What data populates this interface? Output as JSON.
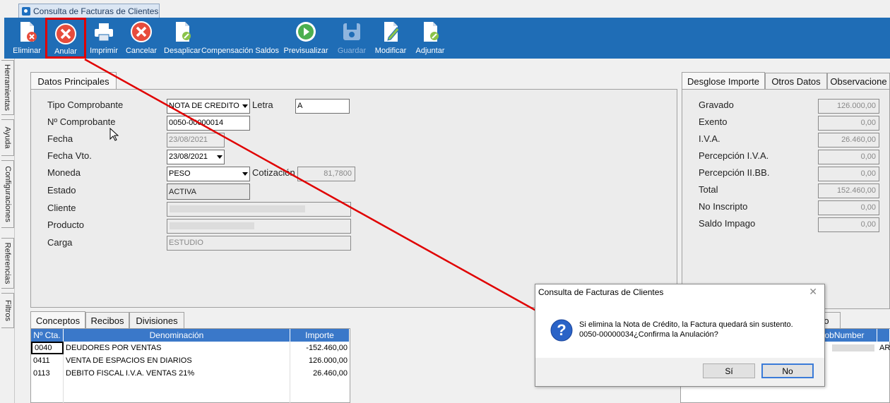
{
  "window": {
    "tab_title": "Consulta de Facturas de Clientes"
  },
  "toolbar": {
    "buttons": [
      {
        "label": "Eliminar",
        "icon": "delete-document-icon",
        "enabled": true
      },
      {
        "label": "Anular",
        "icon": "cancel-x-icon",
        "enabled": true,
        "highlighted": true
      },
      {
        "label": "Imprimir",
        "icon": "printer-icon",
        "enabled": true
      },
      {
        "label": "Cancelar",
        "icon": "cancel-x-icon",
        "enabled": true
      },
      {
        "label": "Desaplicar",
        "icon": "document-edit-icon",
        "enabled": true
      },
      {
        "label": "Compensación Saldos",
        "icon": "document-edit-icon",
        "enabled": true
      },
      {
        "label": "Previsualizar",
        "icon": "play-icon",
        "enabled": true
      },
      {
        "label": "Guardar",
        "icon": "save-icon",
        "enabled": false
      },
      {
        "label": "Modificar",
        "icon": "document-pencil-icon",
        "enabled": true
      },
      {
        "label": "Adjuntar",
        "icon": "document-edit-icon",
        "enabled": true
      }
    ]
  },
  "side_tabs": [
    "Herramientas",
    "Ayuda",
    "Configuraciones",
    "Referencias",
    "Filtros"
  ],
  "main_tab": "Datos Principales",
  "form": {
    "tipo_comprobante_label": "Tipo Comprobante",
    "tipo_comprobante": "NOTA DE CREDITO",
    "letra_label": "Letra",
    "letra": "A",
    "numero_label": "Nº Comprobante",
    "numero": "0050-00000014",
    "fecha_label": "Fecha",
    "fecha": "23/08/2021",
    "fecha_vto_label": "Fecha Vto.",
    "fecha_vto": "23/08/2021",
    "moneda_label": "Moneda",
    "moneda": "PESO",
    "cotizacion_label": "Cotización",
    "cotizacion": "81,7800",
    "estado_label": "Estado",
    "estado": "ACTIVA",
    "cliente_label": "Cliente",
    "producto_label": "Producto",
    "carga_label": "Carga",
    "carga": "ESTUDIO"
  },
  "right_tabs": [
    "Desglose Importe",
    "Otros Datos",
    "Observacione"
  ],
  "desglose": [
    {
      "label": "Gravado",
      "value": "126.000,00"
    },
    {
      "label": "Exento",
      "value": "0,00"
    },
    {
      "label": "I.V.A.",
      "value": "26.460,00"
    },
    {
      "label": "Percepción I.V.A.",
      "value": "0,00"
    },
    {
      "label": "Percepción II.BB.",
      "value": "0,00"
    },
    {
      "label": "Total",
      "value": "152.460,00"
    },
    {
      "label": "No Inscripto",
      "value": "0,00"
    },
    {
      "label": "Saldo Impago",
      "value": "0,00"
    }
  ],
  "bottom_tabs": [
    "Conceptos",
    "Recibos",
    "Divisiones"
  ],
  "conceptos": {
    "headers": [
      "Nº Cta.",
      "Denominación",
      "Importe"
    ],
    "rows": [
      [
        "0040",
        "DEUDORES POR VENTAS",
        "-152.460,00"
      ],
      [
        "0411",
        "VENTA DE ESPACIOS EN DIARIOS",
        "126.000,00"
      ],
      [
        "0113",
        "DEBITO FISCAL I.V.A. VENTAS 21%",
        "26.460,00"
      ]
    ]
  },
  "right_grid": {
    "tab_fragment": "o",
    "header": "JobNumber",
    "cell_fragment": "ART"
  },
  "dialog": {
    "title": "Consulta de Facturas de Clientes",
    "message_line1": "Si elimina la Nota de Crédito, la Factura quedará sin sustento.",
    "message_line2": "0050-00000034¿Confirma la Anulación?",
    "yes_label": "Sí",
    "no_label": "No",
    "close_label": "✕"
  },
  "colors": {
    "toolbar": "#1f6db6",
    "grid_header": "#3a78c9",
    "highlight": "#e00000"
  }
}
